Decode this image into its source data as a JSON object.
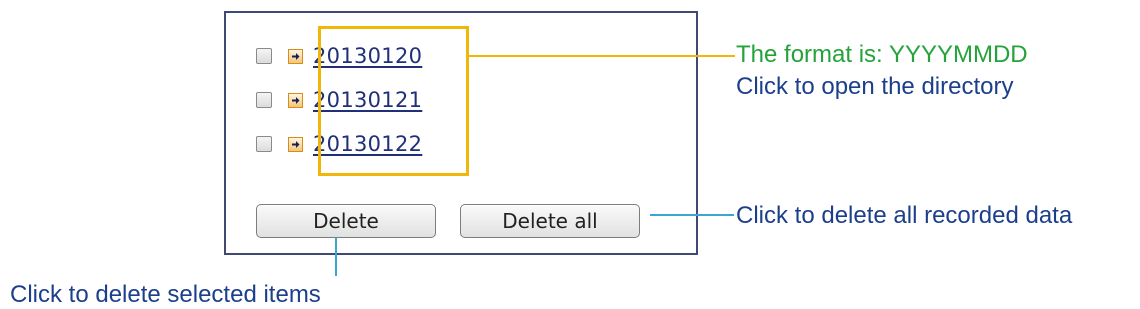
{
  "directory_list": {
    "items": [
      {
        "label": "20130120",
        "checked": false
      },
      {
        "label": "20130121",
        "checked": false
      },
      {
        "label": "20130122",
        "checked": false
      }
    ]
  },
  "buttons": {
    "delete_label": "Delete",
    "delete_all_label": "Delete all"
  },
  "annotations": {
    "format_note": "The format is: YYYYMMDD",
    "open_note": "Click to open the directory",
    "delete_all_note": "Click to delete all recorded data",
    "delete_selected_note": "Click to delete selected items"
  },
  "colors": {
    "highlight": "#f0b60a",
    "callout_line_blue": "#3aa6d6",
    "format_text": "#24a33a",
    "note_text": "#1c3f8c",
    "link_text": "#1f2f7a",
    "panel_border": "#3f4a73"
  },
  "icons": {
    "row_icon": "arrow-right-icon"
  }
}
